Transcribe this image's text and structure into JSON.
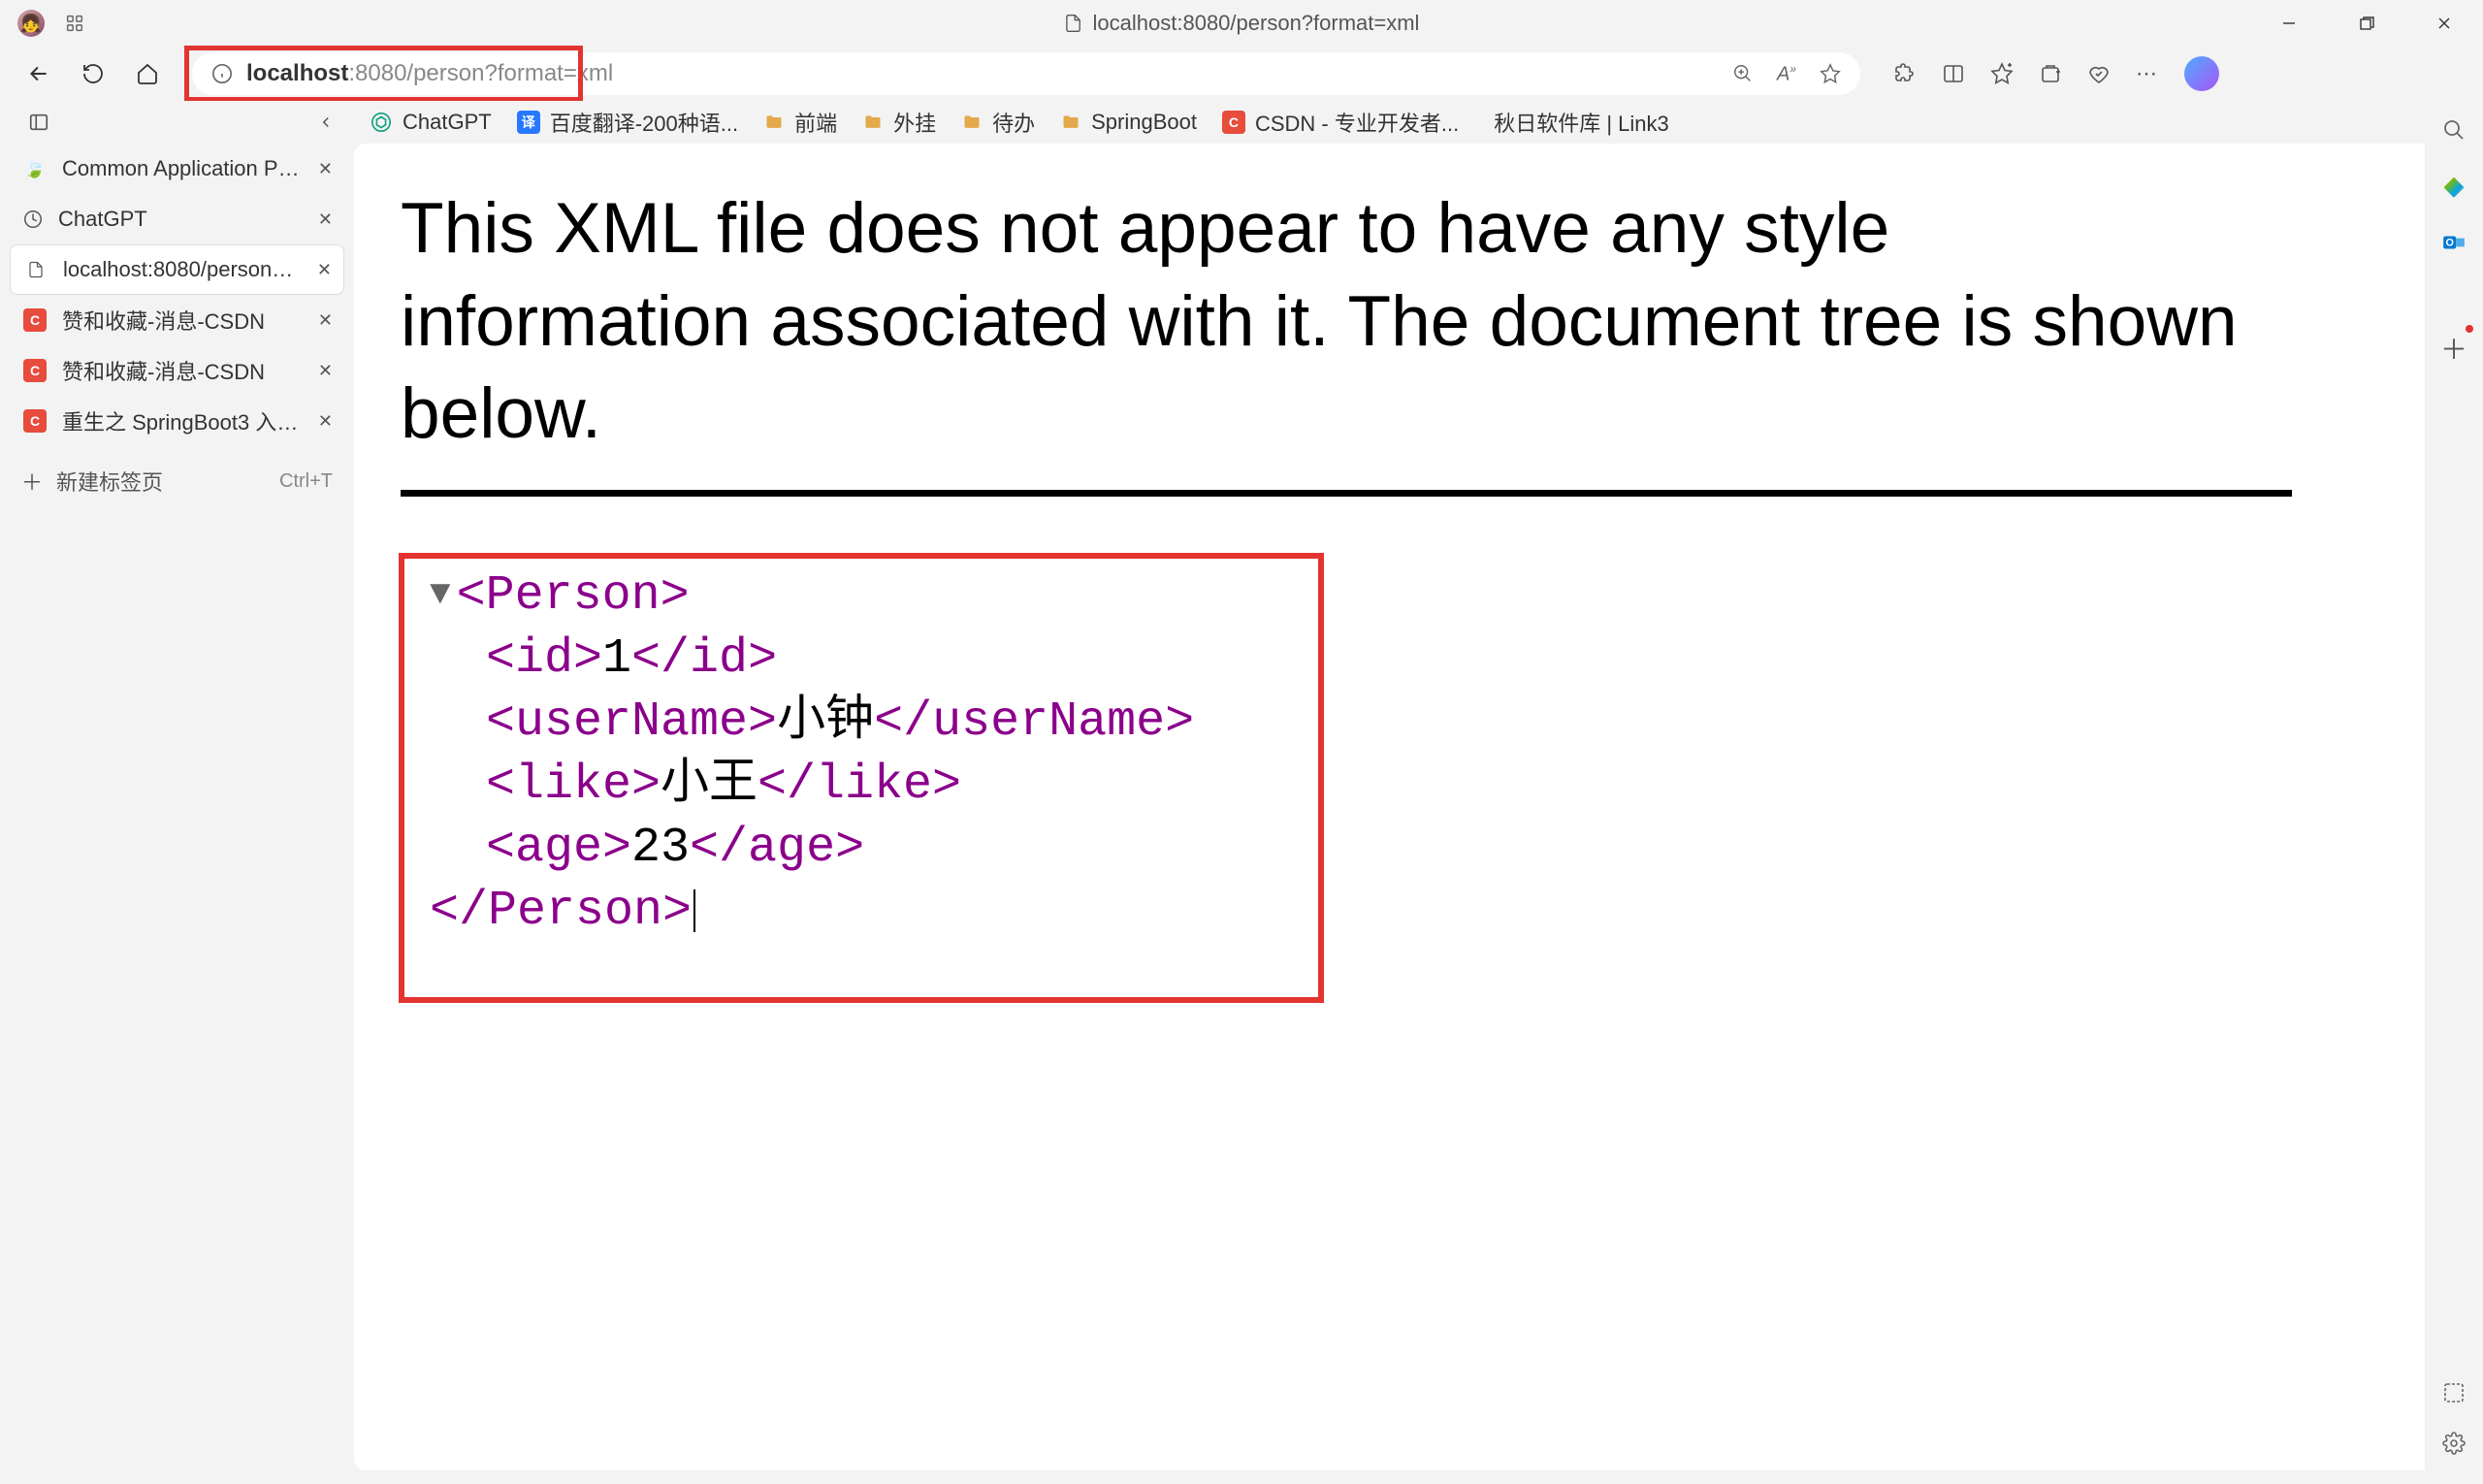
{
  "titlebar": {
    "page_title": "localhost:8080/person?format=xml"
  },
  "address": {
    "host": "localhost",
    "rest": ":8080/person?format=xml"
  },
  "bookmarks": [
    {
      "label": "ChatGPT",
      "kind": "chatgpt"
    },
    {
      "label": "百度翻译-200种语...",
      "kind": "baidu"
    },
    {
      "label": "前端",
      "kind": "folder"
    },
    {
      "label": "外挂",
      "kind": "folder"
    },
    {
      "label": "待办",
      "kind": "folder"
    },
    {
      "label": "SpringBoot",
      "kind": "folder"
    },
    {
      "label": "CSDN - 专业开发者...",
      "kind": "csdn"
    },
    {
      "label": "秋日软件库 | Link3",
      "kind": "link3"
    }
  ],
  "tabs": [
    {
      "label": "Common Application Properties",
      "icon": "spring"
    },
    {
      "label": "ChatGPT",
      "icon": "chatgpt"
    },
    {
      "label": "localhost:8080/person?format=xml",
      "icon": "file",
      "active": true
    },
    {
      "label": "赞和收藏-消息-CSDN",
      "icon": "csdn"
    },
    {
      "label": "赞和收藏-消息-CSDN",
      "icon": "csdn"
    },
    {
      "label": "重生之 SpringBoot3 入门保姆级",
      "icon": "csdn"
    }
  ],
  "newtab": {
    "label": "新建标签页",
    "shortcut": "Ctrl+T"
  },
  "content": {
    "heading": "This XML file does not appear to have any style information associated with it. The document tree is shown below.",
    "xml": {
      "root_open": "<Person>",
      "root_close": "</Person>",
      "children": [
        {
          "open": "<id>",
          "value": "1",
          "close": "</id>"
        },
        {
          "open": "<userName>",
          "value": "小钟",
          "close": "</userName>"
        },
        {
          "open": "<like>",
          "value": "小王",
          "close": "</like>"
        },
        {
          "open": "<age>",
          "value": "23",
          "close": "</age>"
        }
      ]
    }
  }
}
